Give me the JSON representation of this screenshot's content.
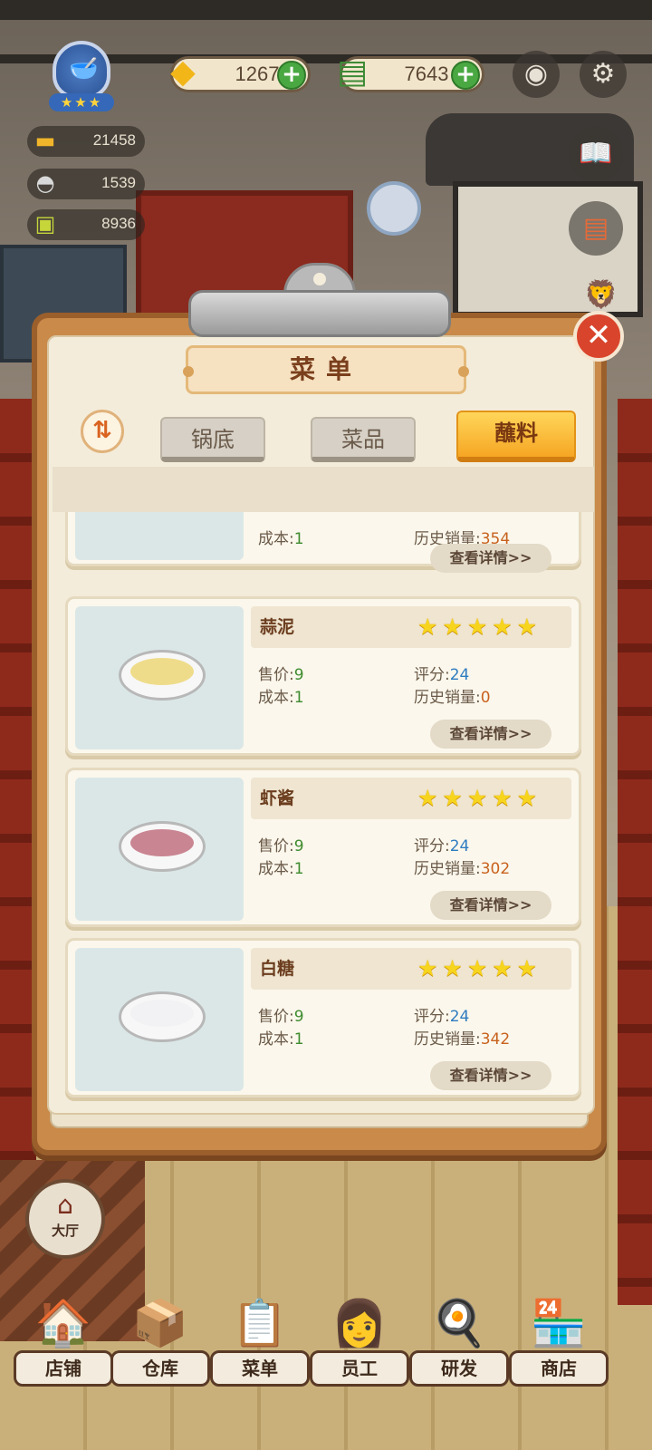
{
  "hud": {
    "level_stars": "★★★",
    "gold": "1267",
    "cash": "7643",
    "stats": [
      "21458",
      "1539",
      "8936"
    ]
  },
  "menu": {
    "title": "菜单",
    "sort_icon": "⇅",
    "tabs": [
      {
        "label": "锅底",
        "active": false
      },
      {
        "label": "菜品",
        "active": false
      },
      {
        "label": "蘸料",
        "active": true
      }
    ],
    "labels": {
      "price": "售价:",
      "cost": "成本:",
      "rating": "评分:",
      "sales": "历史销量:",
      "detail": "查看详情>>"
    },
    "items": [
      {
        "name": "",
        "stars": "",
        "price": "",
        "cost": "1",
        "rating": "",
        "sales": "354",
        "food_color": "#7fc36a"
      },
      {
        "name": "蒜泥",
        "stars": "★★★★★",
        "price": "9",
        "cost": "1",
        "rating": "24",
        "sales": "0",
        "food_color": "#efdc8a"
      },
      {
        "name": "虾酱",
        "stars": "★★★★★",
        "price": "9",
        "cost": "1",
        "rating": "24",
        "sales": "302",
        "food_color": "#c98592"
      },
      {
        "name": "白糖",
        "stars": "★★★★★",
        "price": "9",
        "cost": "1",
        "rating": "24",
        "sales": "342",
        "food_color": "#f2f2f4"
      }
    ]
  },
  "hall_button": "大厅",
  "nav": [
    "店铺",
    "仓库",
    "菜单",
    "员工",
    "研发",
    "商店"
  ],
  "icons": {
    "close": "✕",
    "camera": "camera-icon",
    "settings": "gear-icon"
  }
}
